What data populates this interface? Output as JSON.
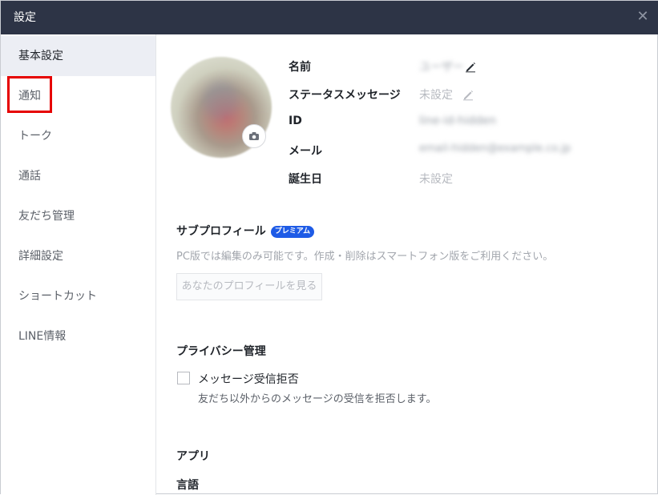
{
  "window": {
    "title": "設定"
  },
  "sidebar": {
    "items": [
      {
        "label": "基本設定"
      },
      {
        "label": "通知"
      },
      {
        "label": "トーク"
      },
      {
        "label": "通話"
      },
      {
        "label": "友だち管理"
      },
      {
        "label": "詳細設定"
      },
      {
        "label": "ショートカット"
      },
      {
        "label": "LINE情報"
      }
    ]
  },
  "profile": {
    "fields": [
      {
        "label": "名前",
        "value": "ユーザー"
      },
      {
        "label": "ステータスメッセージ",
        "value": "未設定"
      },
      {
        "label": "ID",
        "value": "line-id-hidden"
      },
      {
        "label": "メール",
        "value": "email-hidden@example.co.jp"
      },
      {
        "label": "誕生日",
        "value": "未設定"
      }
    ]
  },
  "subprofile": {
    "title": "サブプロフィール",
    "badge": "プレミアム",
    "description": "PC版では編集のみ可能です。作成・削除はスマートフォン版をご利用ください。",
    "button": "あなたのプロフィールを見る"
  },
  "privacy": {
    "title": "プライバシー管理",
    "option_label": "メッセージ受信拒否",
    "option_desc": "友だち以外からのメッセージの受信を拒否します。",
    "checked": false
  },
  "app": {
    "title": "アプリ"
  },
  "language": {
    "title": "言語"
  },
  "colors": {
    "titlebar": "#2d3446",
    "active": "#eceef4",
    "badge": "#1e5be6",
    "highlight": "#e60000"
  },
  "icons": {
    "close": "close-icon",
    "camera": "camera-icon",
    "pencil": "pencil-icon"
  }
}
